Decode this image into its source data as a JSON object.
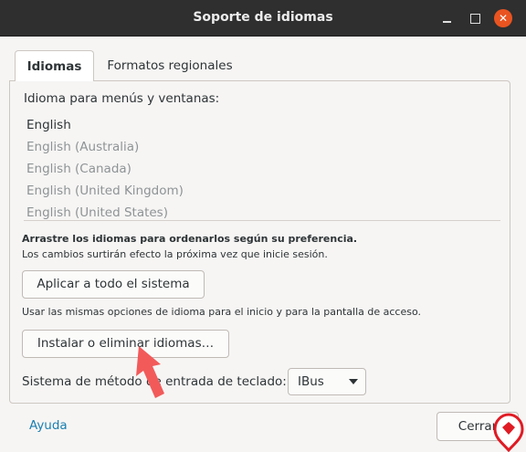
{
  "window": {
    "title": "Soporte de idiomas",
    "close_glyph": "✕"
  },
  "tabs": [
    {
      "label": "Idiomas",
      "active": true
    },
    {
      "label": "Formatos regionales",
      "active": false
    }
  ],
  "languages": {
    "heading": "Idioma para menús y ventanas:",
    "items": [
      "English",
      "English (Australia)",
      "English (Canada)",
      "English (United Kingdom)",
      "English (United States)"
    ]
  },
  "hints": {
    "drag": "Arrastre los idiomas para ordenarlos según su preferencia.",
    "effect": "Los cambios surtirán efecto la próxima vez que inicie sesión.",
    "apply": "Usar las mismas opciones de idioma para el inicio y para la pantalla de acceso."
  },
  "buttons": {
    "apply_all": "Aplicar a todo el sistema",
    "install_remove": "Instalar o eliminar idiomas…",
    "close": "Cerrar"
  },
  "keyboard": {
    "label": "Sistema de método de entrada de teclado:",
    "selected": "IBus"
  },
  "help_link": "Ayuda",
  "colors": {
    "accent": "#e95420",
    "link": "#1a7fb0",
    "annotation_arrow": "#f25a5a"
  },
  "icons": [
    "minimize-icon",
    "maximize-icon",
    "close-icon",
    "chevron-down-icon",
    "annotation-arrow",
    "watermark-logo"
  ]
}
